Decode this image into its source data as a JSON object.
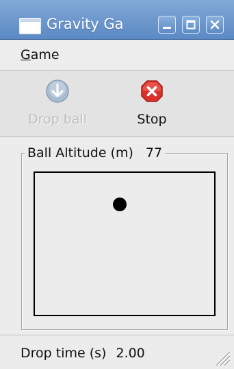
{
  "window": {
    "title": "Gravity Ga"
  },
  "title_buttons": {
    "minimize_icon": "minimize-icon",
    "maximize_icon": "maximize-icon",
    "close_icon": "close-icon"
  },
  "menu": {
    "game_mnemonic": "G",
    "game_rest": "ame"
  },
  "toolbar": {
    "drop_label": "Drop ball",
    "drop_icon": "down-arrow-icon",
    "drop_enabled": false,
    "stop_label": "Stop",
    "stop_icon": "stop-icon"
  },
  "altitude": {
    "label": "Ball Altitude (m)",
    "value": "77"
  },
  "status": {
    "label": "Drop time (s)",
    "value": "2.00"
  },
  "colors": {
    "titlebar": "#5b89c4",
    "stop_red": "#d9302b",
    "disabled_text": "#bdbdbd"
  }
}
